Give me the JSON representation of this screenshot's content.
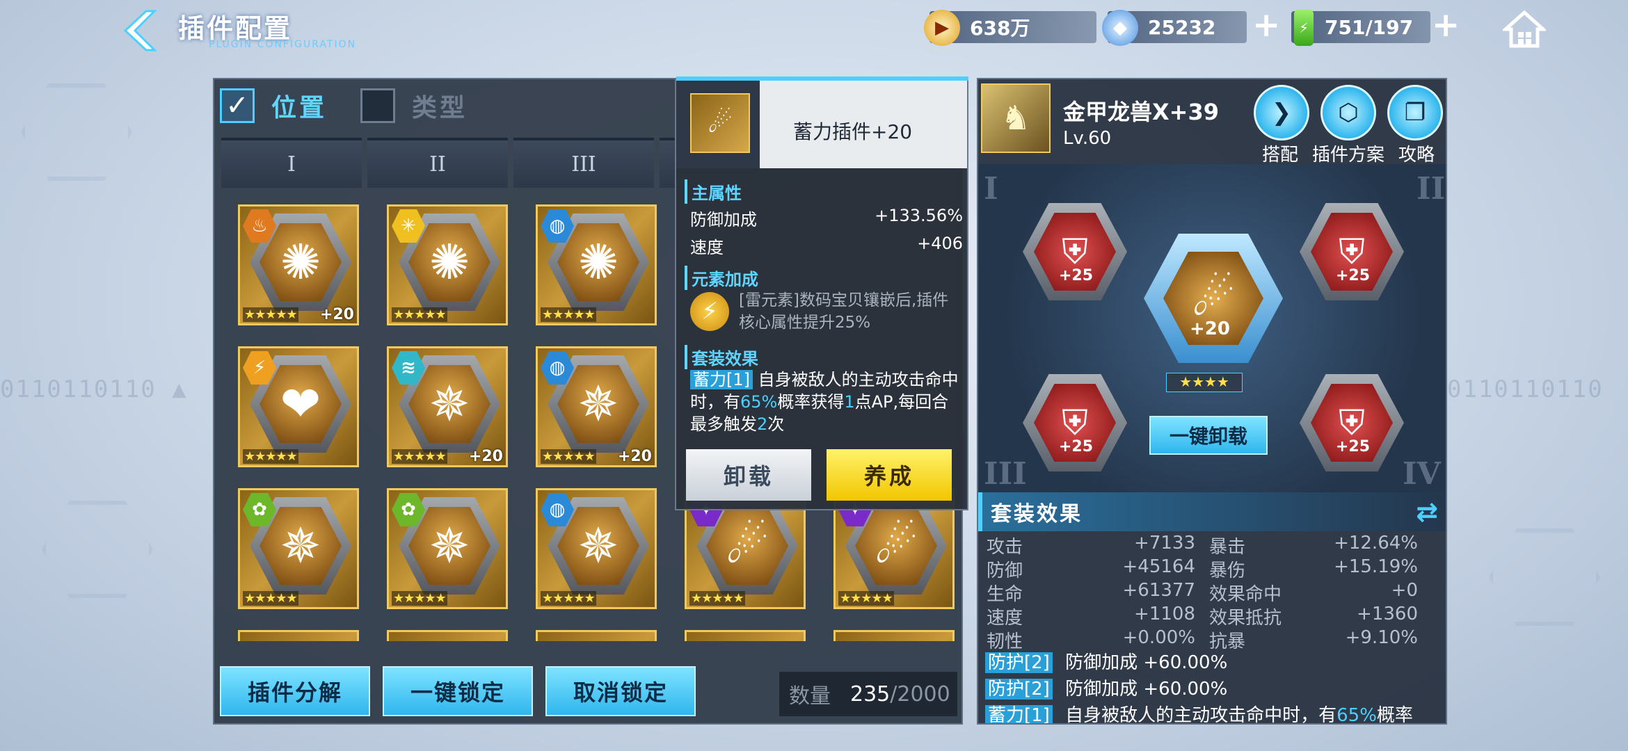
{
  "header": {
    "title": "插件配置",
    "subtitle": "PLUGIN CONFIGURATION",
    "resources": [
      {
        "icon": "coin-icon",
        "value": "638万"
      },
      {
        "icon": "crystal-icon",
        "value": "25232"
      },
      {
        "icon": "battery-icon",
        "value": "751/197"
      }
    ]
  },
  "filters": {
    "position": "位置",
    "type": "类型"
  },
  "tabs": [
    "I",
    "II",
    "III"
  ],
  "plugins": [
    {
      "element": "fire",
      "icon": "virus",
      "stars": "★★★★★",
      "level": "+20"
    },
    {
      "element": "light",
      "icon": "virus",
      "stars": "★★★★★",
      "level": ""
    },
    {
      "element": "water",
      "icon": "virus",
      "stars": "★★★★★",
      "level": ""
    },
    {
      "element": "thunder",
      "icon": "heart",
      "stars": "★★★★★",
      "level": ""
    },
    {
      "element": "wind",
      "icon": "shield",
      "stars": "★★★★★",
      "level": "+20"
    },
    {
      "element": "water",
      "icon": "shield",
      "stars": "★★★★★",
      "level": "+20"
    },
    {
      "element": "wood",
      "icon": "shield",
      "stars": "★★★★★",
      "level": ""
    },
    {
      "element": "wood",
      "icon": "shield",
      "stars": "★★★★★",
      "level": ""
    },
    {
      "element": "water",
      "icon": "shield",
      "stars": "★★★★★",
      "level": ""
    },
    {
      "element": "dark",
      "icon": "claw",
      "stars": "★★★★★",
      "level": ""
    },
    {
      "element": "dark",
      "icon": "claw",
      "stars": "★★★★★",
      "level": ""
    }
  ],
  "buttons": {
    "decompose": "插件分解",
    "lock_all": "一键锁定",
    "unlock": "取消锁定"
  },
  "count": {
    "label": "数量",
    "current": "235",
    "max": "/2000"
  },
  "tooltip": {
    "name": "蓄力插件+20",
    "main_attr_title": "主属性",
    "main_attrs": [
      {
        "name": "防御加成",
        "value": "+133.56%"
      },
      {
        "name": "速度",
        "value": "+406"
      }
    ],
    "element_title": "元素加成",
    "element_text": "[雷元素]数码宝贝镶嵌后,插件核心属性提升25%",
    "set_title": "套装效果",
    "set_tag": "蓄力[1]",
    "set_text_a": "自身被敌人的主动攻击命中时，有",
    "set_pct": "65%",
    "set_text_b": "概率获得",
    "set_n": "1",
    "set_text_c": "点AP,每回合最多触发",
    "set_m": "2",
    "set_text_d": "次",
    "unload": "卸载",
    "develop": "养成"
  },
  "digimon": {
    "name": "金甲龙兽X+39",
    "level": "Lv.60"
  },
  "right_actions": [
    {
      "label": "搭配",
      "icon": "match-icon"
    },
    {
      "label": "插件方案",
      "icon": "plugin-plan-icon"
    },
    {
      "label": "攻略",
      "icon": "guide-icon"
    }
  ],
  "slots": {
    "side_level": "+25",
    "center_level": "+20",
    "center_stars": "★★★★",
    "unload_all": "一键卸载"
  },
  "set_effect": {
    "title": "套装效果",
    "stats": [
      {
        "name": "攻击",
        "value": "+7133"
      },
      {
        "name": "暴击",
        "value": "+12.64%"
      },
      {
        "name": "防御",
        "value": "+45164"
      },
      {
        "name": "暴伤",
        "value": "+15.19%"
      },
      {
        "name": "生命",
        "value": "+61377"
      },
      {
        "name": "效果命中",
        "value": "+0"
      },
      {
        "name": "速度",
        "value": "+1108"
      },
      {
        "name": "效果抵抗",
        "value": "+1360"
      },
      {
        "name": "韧性",
        "value": "+0.00%"
      },
      {
        "name": "抗暴",
        "value": "+9.10%"
      }
    ],
    "lines": [
      {
        "tag": "防护[2]",
        "text": "防御加成 +60.00%"
      },
      {
        "tag": "防护[2]",
        "text": "防御加成 +60.00%"
      },
      {
        "tag": "蓄力[1]",
        "text": "自身被敌人的主动攻击命中时，有",
        "pct": "65%",
        "tail": "概率"
      }
    ]
  },
  "colors": {
    "accent": "#4bd0ff",
    "gold": "#f1c95c",
    "panel": "#303a48"
  }
}
